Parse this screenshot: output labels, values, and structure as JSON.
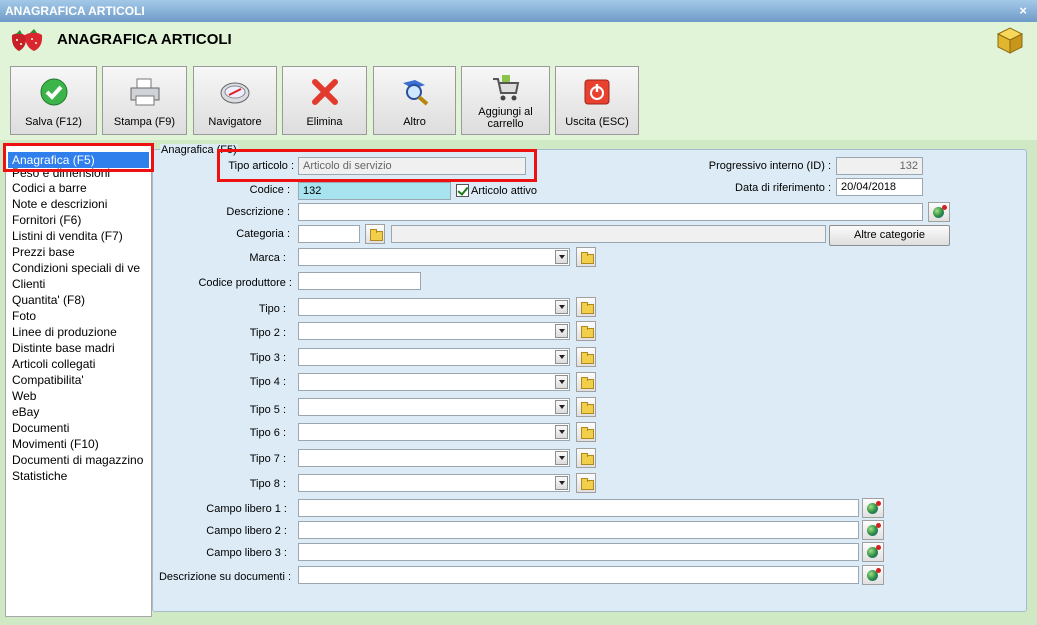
{
  "window": {
    "title": "ANAGRAFICA ARTICOLI",
    "close_label": "×"
  },
  "header": {
    "title": "ANAGRAFICA ARTICOLI"
  },
  "toolbar": {
    "salva": "Salva (F12)",
    "stampa": "Stampa (F9)",
    "navigatore": "Navigatore",
    "elimina": "Elimina",
    "altro": "Altro",
    "carrello_1": "Aggiungi al",
    "carrello_2": "carrello",
    "uscita": "Uscita (ESC)"
  },
  "sidebar": {
    "items": [
      "Anagrafica (F5)",
      "Peso e dimensioni",
      "Codici a barre",
      "Note e descrizioni",
      "Fornitori (F6)",
      "Listini di vendita (F7)",
      "Prezzi base",
      "Condizioni speciali di ve",
      "Clienti",
      "Quantita' (F8)",
      "Foto",
      "Linee di produzione",
      "Distinte base madri",
      "Articoli collegati",
      "Compatibilita'",
      "Web",
      "eBay",
      "Documenti",
      "Movimenti (F10)",
      "Documenti di magazzino",
      "Statistiche"
    ]
  },
  "form": {
    "group_title": "Anagrafica (F5)",
    "tipo_articolo_label": "Tipo articolo :",
    "tipo_articolo_value": "Articolo di servizio",
    "progressivo_label": "Progressivo interno (ID) :",
    "progressivo_value": "132",
    "codice_label": "Codice :",
    "codice_value": "132",
    "articolo_attivo_label": "Articolo attivo",
    "data_rif_label": "Data di riferimento :",
    "data_rif_value": "20/04/2018",
    "descrizione_label": "Descrizione :",
    "categoria_label": "Categoria :",
    "altre_categorie": "Altre categorie",
    "marca_label": "Marca :",
    "codice_produttore_label": "Codice produttore :",
    "tipo_label": "Tipo :",
    "tipo2_label": "Tipo 2 :",
    "tipo3_label": "Tipo 3 :",
    "tipo4_label": "Tipo 4 :",
    "tipo5_label": "Tipo 5 :",
    "tipo6_label": "Tipo 6 :",
    "tipo7_label": "Tipo 7 :",
    "tipo8_label": "Tipo 8 :",
    "campo1_label": "Campo libero 1 :",
    "campo2_label": "Campo libero 2 :",
    "campo3_label": "Campo libero 3 :",
    "descr_doc_label": "Descrizione su documenti :"
  }
}
